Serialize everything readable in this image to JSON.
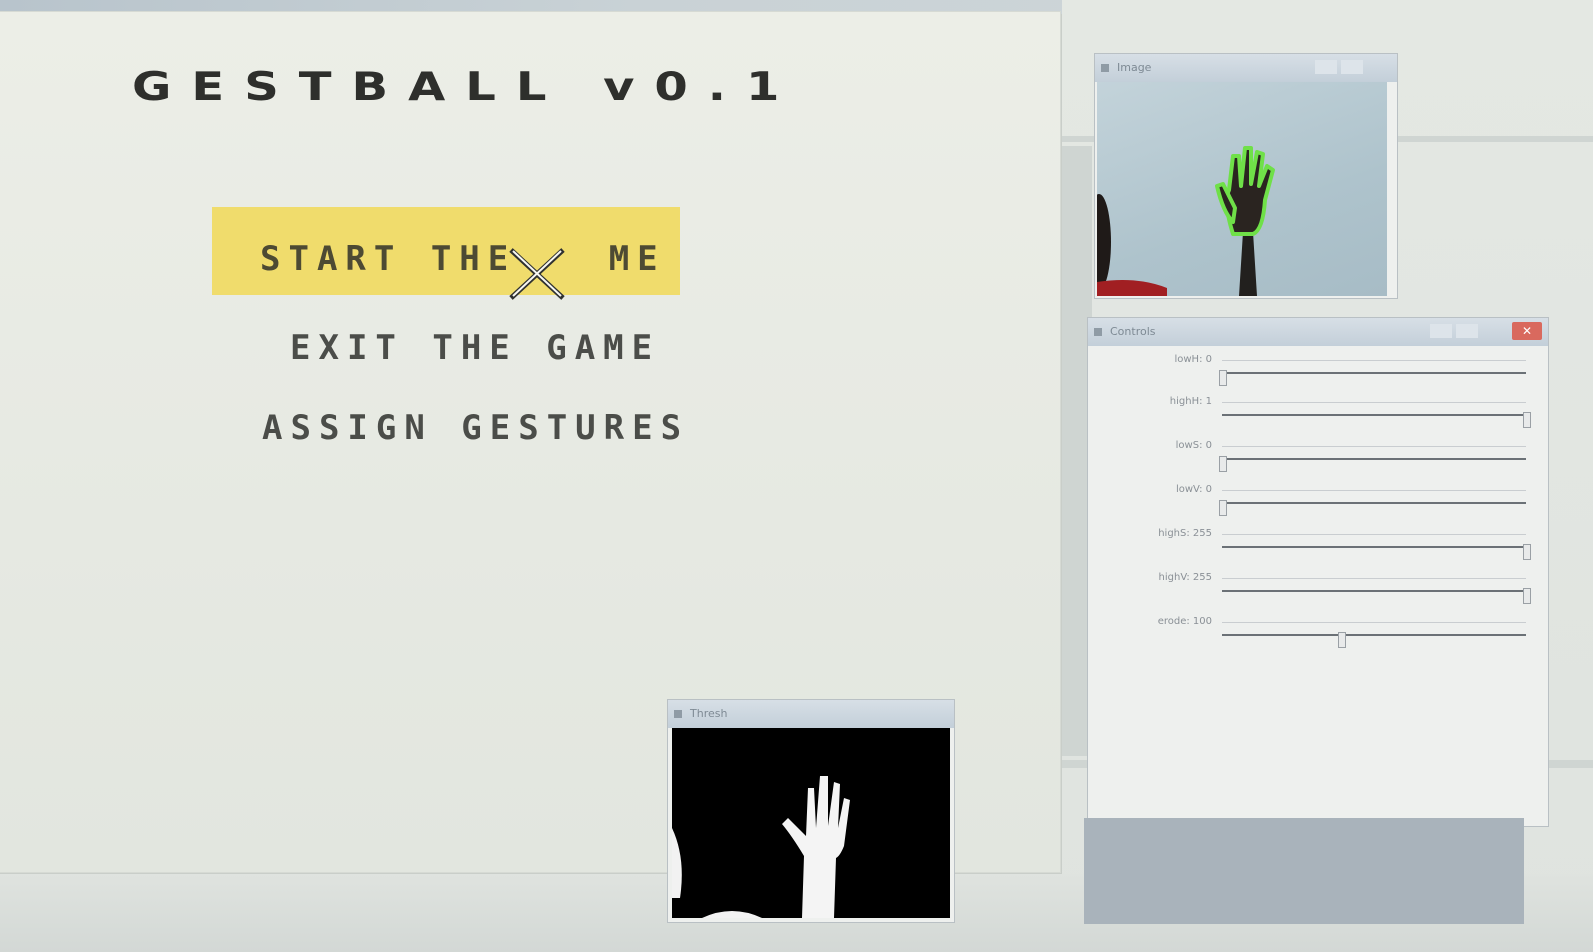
{
  "game": {
    "title": "GESTBALL v0.1",
    "menu": {
      "start": "START THE GA ME",
      "start_display": "START THE ",
      "start_tail": "ME",
      "exit": "EXIT THE GAME",
      "assign": "ASSIGN GESTURES"
    },
    "highlight_color": "#f0dc6c"
  },
  "camera_window": {
    "title": "Image",
    "icon": "window-icon"
  },
  "controls_window": {
    "title": "Controls",
    "close_icon": "close-icon",
    "sliders": [
      {
        "label": "lowH: 0",
        "value": 0,
        "max": 179
      },
      {
        "label": "highH: 1",
        "value": 179,
        "max": 179
      },
      {
        "label": "lowS: 0",
        "value": 0,
        "max": 255
      },
      {
        "label": "lowV: 0",
        "value": 0,
        "max": 255
      },
      {
        "label": "highS: 255",
        "value": 255,
        "max": 255
      },
      {
        "label": "highV: 255",
        "value": 255,
        "max": 255
      },
      {
        "label": "erode: 100",
        "value": 100,
        "max": 255
      }
    ]
  },
  "threshold_window": {
    "title": "Thresh"
  }
}
